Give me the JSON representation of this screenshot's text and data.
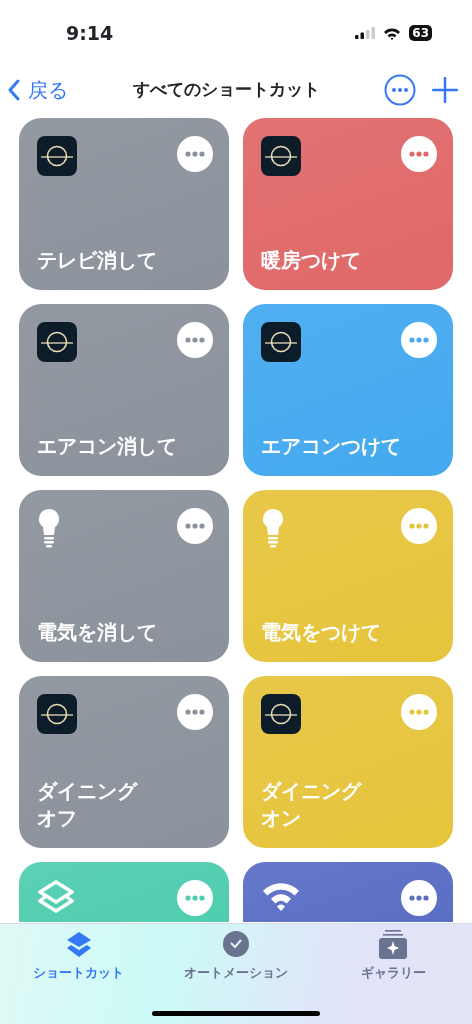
{
  "status_bar": {
    "time": "9:14",
    "battery": "63"
  },
  "nav": {
    "back": "戻る",
    "title": "すべてのショートカット"
  },
  "shortcuts": [
    {
      "label": "テレビ消して",
      "kind": "app",
      "color": "#8b929b"
    },
    {
      "label": "暖房つけて",
      "kind": "app",
      "color": "#e06868"
    },
    {
      "label": "エアコン消して",
      "kind": "app",
      "color": "#8b929b"
    },
    {
      "label": "エアコンつけて",
      "kind": "app",
      "color": "#44a9ef"
    },
    {
      "label": "電気を消して",
      "kind": "bulb",
      "color": "#8b929b"
    },
    {
      "label": "電気をつけて",
      "kind": "bulb",
      "color": "#e6c43c"
    },
    {
      "label_lines": [
        "ダイニング",
        "オフ"
      ],
      "kind": "app",
      "color": "#8b929b"
    },
    {
      "label_lines": [
        "ダイニング",
        "オン"
      ],
      "kind": "app",
      "color": "#e6c43c"
    },
    {
      "kind": "layers",
      "color": "#50cdb0"
    },
    {
      "kind": "wifi",
      "color": "#5a6ec4"
    }
  ],
  "tabs": [
    {
      "label": "ショートカット",
      "kind": "layers",
      "selected": true
    },
    {
      "label": "オートメーション",
      "kind": "clock",
      "selected": false
    },
    {
      "label": "ギャラリー",
      "kind": "gallery",
      "selected": false
    }
  ]
}
